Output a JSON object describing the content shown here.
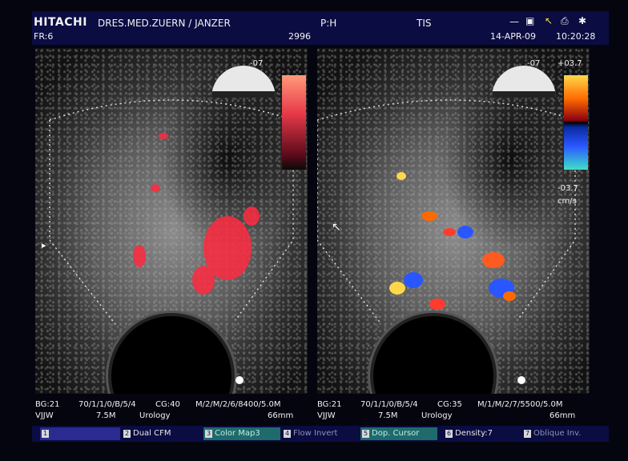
{
  "header": {
    "brand": "HITACHI",
    "institution": "DRES.MED.ZUERN / JANZER",
    "frame": "FR:6",
    "frame_id": "2996",
    "preset": "P:H",
    "tis": "TIS",
    "date": "14-APR-09",
    "time": "10:20:28"
  },
  "left_panel": {
    "gauge_label": "-07",
    "marker": "▸"
  },
  "right_panel": {
    "gauge_label": "-07",
    "scale_top": "+03.7",
    "scale_bottom": "-03.7",
    "scale_unit": "cm/s",
    "marker": "▸"
  },
  "left_info": {
    "line1_a": "BG:21",
    "line1_b": "70/1/1/0/B/5/4",
    "line1_c": "CG:40",
    "line1_d": "M/2/M/2/6/8400/5.0M",
    "line2_a": "VJJW",
    "line2_b": "7.5M",
    "line2_c": "Urology",
    "line2_d": "66mm"
  },
  "right_info": {
    "line1_a": "BG:21",
    "line1_b": "70/1/1/0/B/5/4",
    "line1_c": "CG:35",
    "line1_d": "M/1/M/2/7/5500/5.0M",
    "line2_a": "VJJW",
    "line2_b": "7.5M",
    "line2_c": "Urology",
    "line2_d": "66mm"
  },
  "softkeys": [
    {
      "num": "1",
      "label": ""
    },
    {
      "num": "2",
      "label": "Dual CFM"
    },
    {
      "num": "3",
      "label": "Color Map3"
    },
    {
      "num": "4",
      "label": "Flow Invert"
    },
    {
      "num": "5",
      "label": "Dop. Cursor"
    },
    {
      "num": "6",
      "label": "Density:7"
    },
    {
      "num": "7",
      "label": "Oblique Inv."
    }
  ],
  "colors": {
    "header_bg": "#0a0c42",
    "key_highlight": "#2a2a90",
    "key_teal": "#1f6a6a"
  }
}
